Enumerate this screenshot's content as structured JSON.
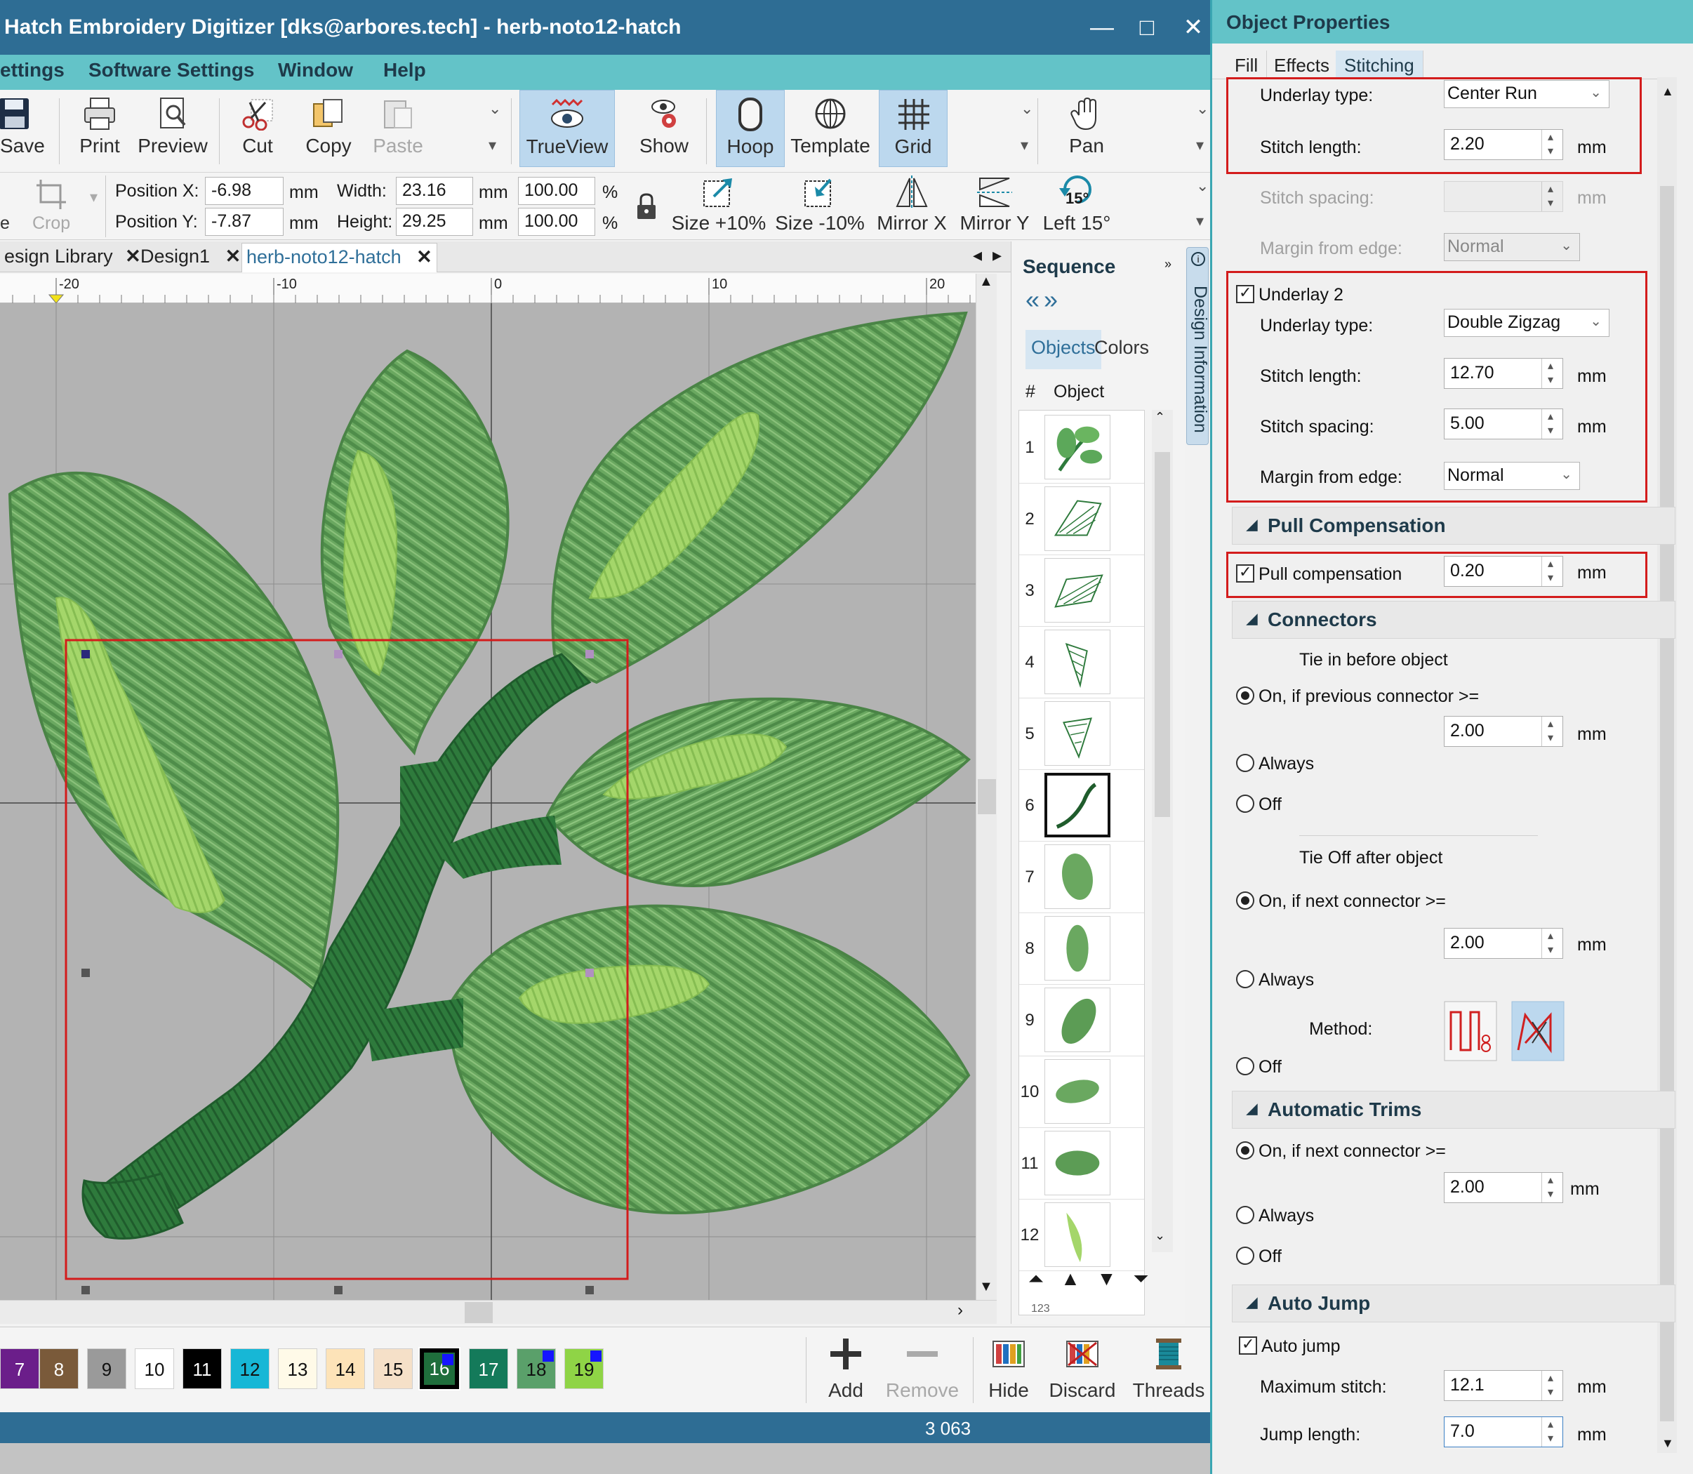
{
  "window": {
    "title": "Hatch Embroidery Digitizer [dks@arbores.tech] - herb-noto12-hatch",
    "minimize_glyph": "—",
    "maximize_glyph": "□",
    "close_glyph": "✕"
  },
  "menu": [
    "ettings",
    "Software Settings",
    "Window",
    "Help"
  ],
  "toolbar1": {
    "save": "Save",
    "print": "Print",
    "preview": "Preview",
    "cut": "Cut",
    "copy": "Copy",
    "paste": "Paste",
    "trueview": "TrueView",
    "show": "Show",
    "hoop": "Hoop",
    "template": "Template",
    "grid": "Grid",
    "pan": "Pan"
  },
  "toolbar2": {
    "edge_label": "e",
    "crop": "Crop",
    "position_x_label": "Position X:",
    "position_x": "-6.98",
    "position_y_label": "Position Y:",
    "position_y": "-7.87",
    "width_label": "Width:",
    "width": "23.16",
    "height_label": "Height:",
    "height": "29.25",
    "width_pct": "100.00",
    "height_pct": "100.00",
    "unit_mm": "mm",
    "unit_pct": "%",
    "size_up": "Size +10%",
    "size_down": "Size -10%",
    "mirror_x": "Mirror X",
    "mirror_y": "Mirror Y",
    "left15": "Left 15°",
    "rotate_badge": "15°"
  },
  "doc_tabs": [
    {
      "label": "esign Library",
      "close": "✕"
    },
    {
      "label": "Design1",
      "close": "✕"
    },
    {
      "label": "herb-noto12-hatch",
      "close": "✕"
    }
  ],
  "tab_nav": {
    "left": "◂",
    "right": "▸"
  },
  "ruler": [
    "-20",
    "-10",
    "0",
    "10",
    "20"
  ],
  "sequence": {
    "title": "Sequence",
    "tab_objects": "Objects",
    "tab_colors": "Colors",
    "col_num": "#",
    "col_object": "Object",
    "nav_back": "«",
    "nav_fwd": "»",
    "rows": [
      "1",
      "2",
      "3",
      "4",
      "5",
      "6",
      "7",
      "8",
      "9",
      "10",
      "11",
      "12"
    ],
    "selected_row": "6",
    "move_controls": "⏶ ▲ ▼ ⏷",
    "footer_badge": "123"
  },
  "design_info": "Design Information",
  "colorbar": {
    "swatches": [
      {
        "num": "7",
        "color": "#6b1e8a",
        "text": "#ffffff",
        "mark": false,
        "selected": false
      },
      {
        "num": "8",
        "color": "#7a5a3a",
        "text": "#ffffff",
        "mark": false,
        "selected": false
      },
      {
        "num": "9",
        "color": "#9a9a9a",
        "text": "#111111",
        "mark": false,
        "selected": false
      },
      {
        "num": "10",
        "color": "#ffffff",
        "text": "#111111",
        "mark": false,
        "selected": false
      },
      {
        "num": "11",
        "color": "#000000",
        "text": "#ffffff",
        "mark": false,
        "selected": false
      },
      {
        "num": "12",
        "color": "#17b7d6",
        "text": "#111111",
        "mark": false,
        "selected": false
      },
      {
        "num": "13",
        "color": "#fffae8",
        "text": "#111111",
        "mark": false,
        "selected": false
      },
      {
        "num": "14",
        "color": "#fde3b8",
        "text": "#111111",
        "mark": false,
        "selected": false
      },
      {
        "num": "15",
        "color": "#f5e0c8",
        "text": "#111111",
        "mark": false,
        "selected": false
      },
      {
        "num": "16",
        "color": "#1f6e3c",
        "text": "#ffffff",
        "mark": true,
        "selected": true
      },
      {
        "num": "17",
        "color": "#147a5a",
        "text": "#ffffff",
        "mark": false,
        "selected": false
      },
      {
        "num": "18",
        "color": "#5aa06a",
        "text": "#111111",
        "mark": true,
        "selected": false
      },
      {
        "num": "19",
        "color": "#8fd446",
        "text": "#111111",
        "mark": true,
        "selected": false
      }
    ],
    "add": "Add",
    "remove": "Remove",
    "hide": "Hide",
    "discard": "Discard",
    "threads": "Threads"
  },
  "status": {
    "stitch_count": "3 063"
  },
  "props": {
    "title": "Object Properties",
    "tabs": [
      "Fill",
      "Effects",
      "Stitching"
    ],
    "underlay1": {
      "type_label": "Underlay type:",
      "type_value": "Center Run",
      "stitch_length_label": "Stitch length:",
      "stitch_length": "2.20",
      "stitch_spacing_label": "Stitch spacing:",
      "stitch_spacing": "",
      "margin_label": "Margin from edge:",
      "margin_value": "Normal"
    },
    "underlay2": {
      "checkbox_label": "Underlay 2",
      "type_label": "Underlay type:",
      "type_value": "Double Zigzag",
      "stitch_length_label": "Stitch length:",
      "stitch_length": "12.70",
      "stitch_spacing_label": "Stitch spacing:",
      "stitch_spacing": "5.00",
      "margin_label": "Margin from edge:",
      "margin_value": "Normal"
    },
    "pull": {
      "section": "Pull Compensation",
      "checkbox_label": "Pull compensation",
      "value": "0.20"
    },
    "connectors": {
      "section": "Connectors",
      "tie_in_title": "Tie in before object",
      "tie_in_on": "On, if previous connector >=",
      "tie_in_value": "2.00",
      "tie_in_always": "Always",
      "tie_in_off": "Off",
      "tie_off_title": "Tie Off after object",
      "tie_off_on": "On, if next connector >=",
      "tie_off_value": "2.00",
      "tie_off_always": "Always",
      "method_label": "Method:",
      "tie_off_off": "Off"
    },
    "trims": {
      "section": "Automatic Trims",
      "on": "On, if next connector >=",
      "value": "2.00",
      "always": "Always",
      "off": "Off"
    },
    "autojump": {
      "section": "Auto Jump",
      "checkbox_label": "Auto jump",
      "max_stitch_label": "Maximum stitch:",
      "max_stitch": "12.1",
      "jump_length_label": "Jump length:",
      "jump_length": "7.0"
    },
    "unit": "mm",
    "section_glyph": "◢",
    "dropdown_caret": "⌄",
    "scroll_up": "▲",
    "scroll_down": "▼"
  },
  "colors": {
    "titlebar": "#2e6d94",
    "menubar": "#63c3c8",
    "selection_red": "#d31c1c",
    "canvas": "#b3b3b3",
    "leaf_dark": "#4f8d4a",
    "leaf_mid": "#6aa860",
    "leaf_light": "#a4d66a",
    "stem": "#2e6e38"
  }
}
